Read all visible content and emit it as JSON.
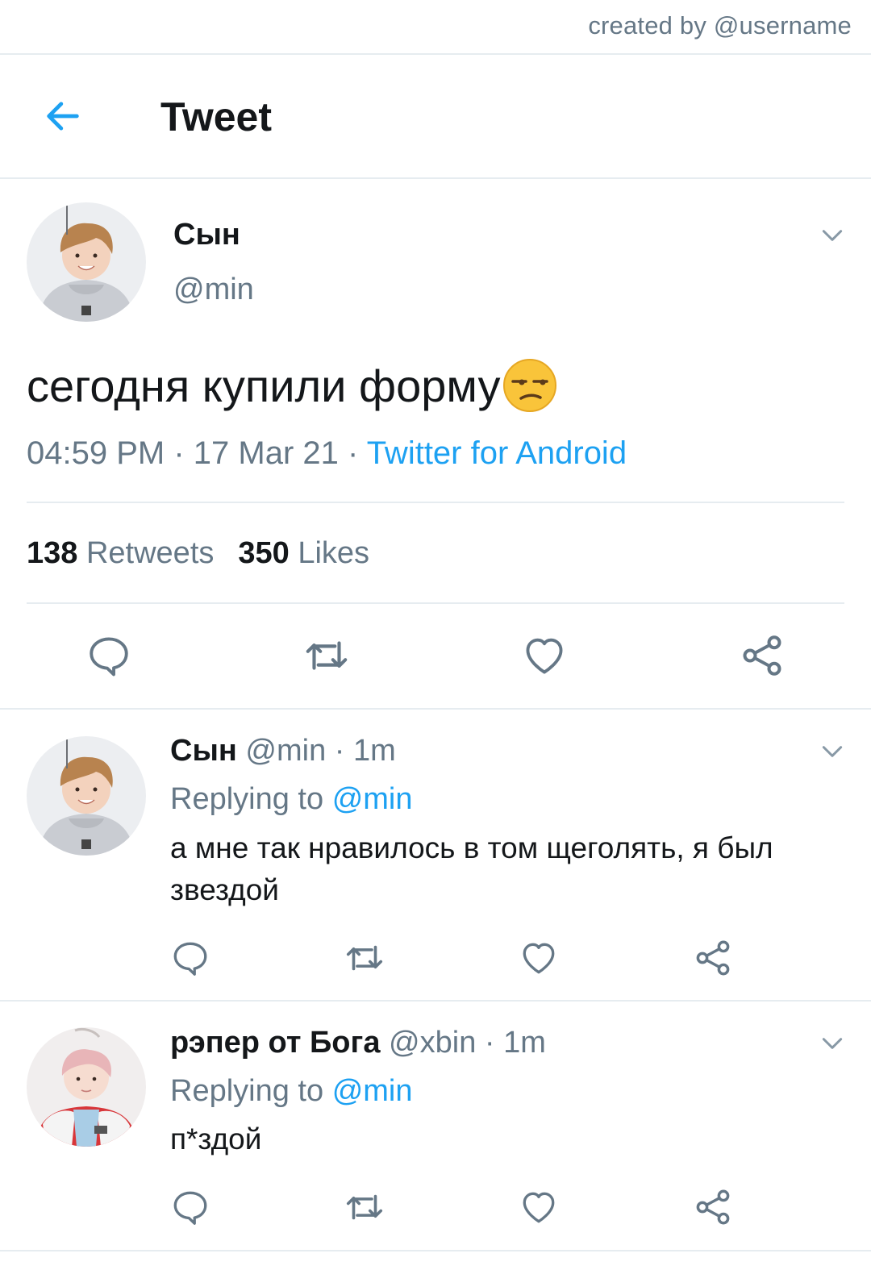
{
  "credit": "created by @username",
  "header": {
    "title": "Tweet",
    "back_icon": "arrow-left-icon"
  },
  "main_tweet": {
    "name": "Сын",
    "handle": "@min",
    "text": "сегодня купили форму",
    "emoji": "unamused-face",
    "time": "04:59 PM",
    "date": "17 Mar 21",
    "source": "Twitter for Android",
    "retweets_count": "138",
    "retweets_label": "Retweets",
    "likes_count": "350",
    "likes_label": "Likes"
  },
  "replies": [
    {
      "name": "Сын",
      "handle": "@min",
      "time": "1m",
      "replying_label": "Replying to",
      "replying_to": "@min",
      "text": "а мне так нравилось в том щеголять, я был звездой"
    },
    {
      "name": "рэпер от Бога",
      "handle": "@xbin",
      "time": "1m",
      "replying_label": "Replying to",
      "replying_to": "@min",
      "text": "п*здой"
    }
  ],
  "colors": {
    "accent": "#1da1f2",
    "muted": "#657786",
    "text": "#14171a",
    "divider": "#e6ecf0"
  },
  "separator": " · "
}
